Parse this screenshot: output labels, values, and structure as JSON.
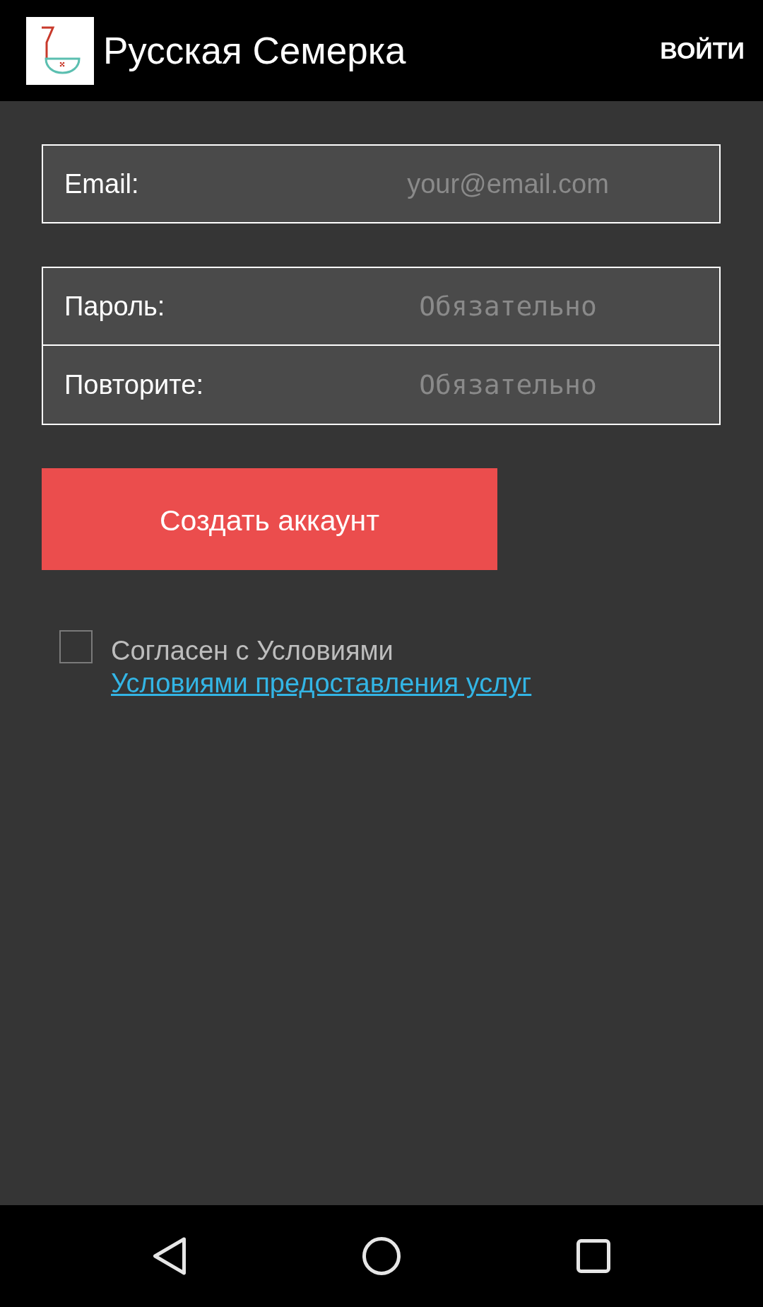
{
  "app_bar": {
    "title": "Русская Семерка",
    "action": "ВОЙТИ"
  },
  "form": {
    "groups": [
      {
        "fields": [
          {
            "kind": "email",
            "label": "Email:",
            "placeholder": "your@email.com"
          }
        ]
      },
      {
        "fields": [
          {
            "kind": "password",
            "label": "Пароль:",
            "placeholder": "Обязательно"
          },
          {
            "kind": "password",
            "label": "Повторите:",
            "placeholder": "Обязательно"
          }
        ]
      }
    ],
    "submit": "Создать аккаунт"
  },
  "terms": {
    "checked": false,
    "text": "Согласен с Условиями",
    "link": "Условиями предоставления услуг"
  }
}
